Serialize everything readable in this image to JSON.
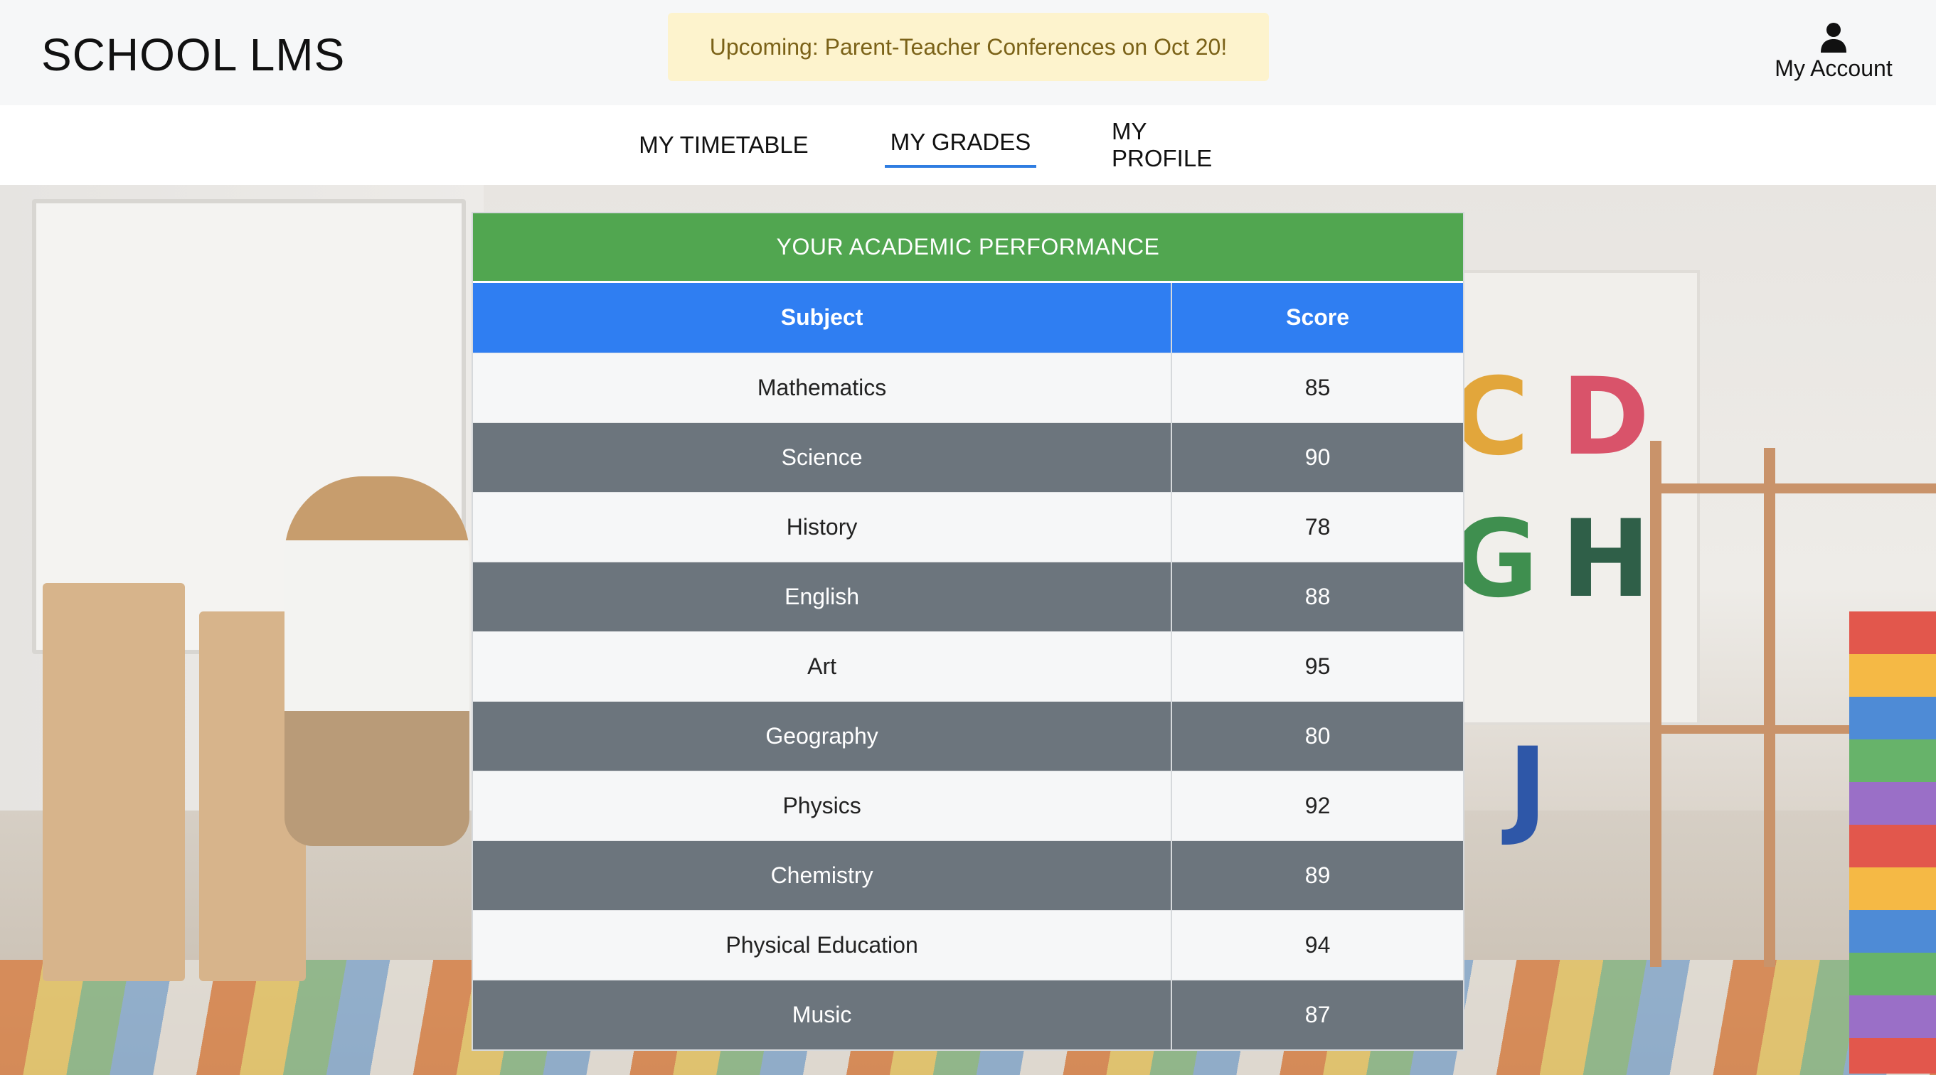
{
  "header": {
    "logo": "SCHOOL LMS",
    "announcement": "Upcoming: Parent-Teacher Conferences on Oct 20!",
    "account_label": "My Account",
    "account_icon": "user-icon"
  },
  "nav": {
    "tabs": [
      {
        "label": "MY TIMETABLE",
        "active": false
      },
      {
        "label": "MY GRADES",
        "active": true
      },
      {
        "label": "MY PROFILE",
        "active": false
      }
    ]
  },
  "background_letters": [
    "C",
    "D",
    "G",
    "H",
    "J"
  ],
  "grades": {
    "title": "YOUR ACADEMIC PERFORMANCE",
    "columns": [
      "Subject",
      "Score"
    ],
    "rows": [
      {
        "subject": "Mathematics",
        "score": "85"
      },
      {
        "subject": "Science",
        "score": "90"
      },
      {
        "subject": "History",
        "score": "78"
      },
      {
        "subject": "English",
        "score": "88"
      },
      {
        "subject": "Art",
        "score": "95"
      },
      {
        "subject": "Geography",
        "score": "80"
      },
      {
        "subject": "Physics",
        "score": "92"
      },
      {
        "subject": "Chemistry",
        "score": "89"
      },
      {
        "subject": "Physical Education",
        "score": "94"
      },
      {
        "subject": "Music",
        "score": "87"
      }
    ]
  },
  "colors": {
    "title_bar": "#51a650",
    "header_row": "#2f7ef2",
    "row_light": "#f6f7f8",
    "row_dark": "#6c757d",
    "active_tab_underline": "#2f7de1",
    "announcement_bg": "#fdf3cd"
  }
}
